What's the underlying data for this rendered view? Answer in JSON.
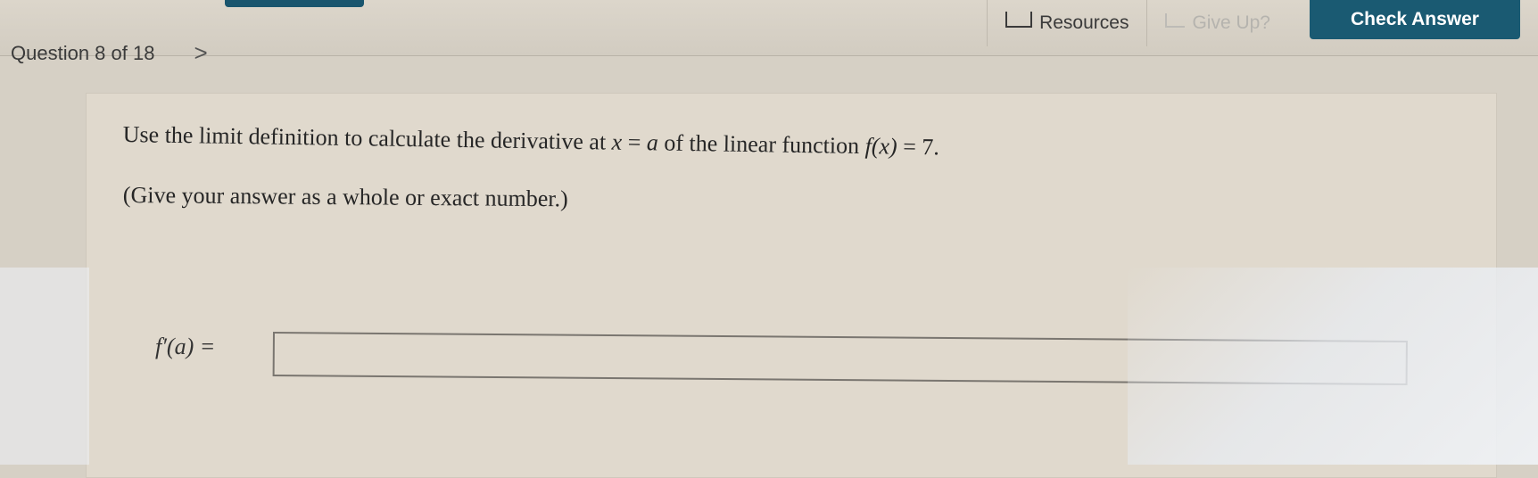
{
  "toolbar": {
    "resources_label": "Resources",
    "giveup_label": "Give Up?",
    "check_label": "Check Answer"
  },
  "nav": {
    "question_counter": "Question 8 of 18",
    "next_glyph": ">"
  },
  "question": {
    "prompt_before_x": "Use the limit definition to calculate the derivative at ",
    "var_x": "x",
    "equals_1": " = ",
    "var_a": "a",
    "prompt_middle": " of the linear function ",
    "func": "f(x)",
    "equals_2": " = 7.",
    "hint": "(Give your answer as a whole or exact number.)",
    "answer_label": "f′(a) =",
    "answer_value": ""
  },
  "colors": {
    "accent": "#1a5a72",
    "background": "#d6d0c5",
    "card": "#e0d9cd"
  },
  "icons": {
    "resources": "resources-icon",
    "giveup": "give-up-icon",
    "next": "chevron-right-icon"
  }
}
